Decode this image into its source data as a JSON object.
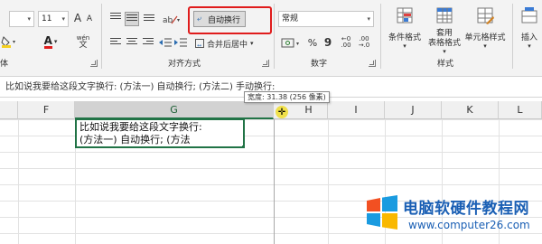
{
  "ribbon": {
    "font_group": {
      "font_size": "11",
      "label": "体",
      "grow_font_icon": "A",
      "shrink_font_icon": "A",
      "font_color_icon": "A",
      "phonetic_icon": "wén"
    },
    "alignment_group": {
      "wrap_text_label": "自动换行",
      "merge_center_label": "合并后居中",
      "label": "对齐方式"
    },
    "number_group": {
      "format_value": "常规",
      "percent_icon": "%",
      "comma_icon": "9",
      "decimal_inc_icon": ".00",
      "label": "数字"
    },
    "styles_group": {
      "conditional_format_label": "条件格式",
      "table_format_label_1": "套用",
      "table_format_label_2": "表格格式",
      "cell_styles_label": "单元格样式",
      "label": "样式"
    },
    "cells_group": {
      "insert_label": "插入"
    }
  },
  "formula_bar": {
    "content": "比如说我要给这段文字换行:   (方法一) 自动换行;   (方法二) 手动换行:"
  },
  "tooltip": {
    "text": "宽度: 31.38 (256 像素)"
  },
  "grid": {
    "columns": [
      "F",
      "G",
      "H",
      "I",
      "J",
      "K",
      "L"
    ],
    "active_cell_lines": [
      "比如说我要给这段文字换行:",
      " (方法一) 自动换行;  (方法"
    ]
  },
  "watermark": {
    "title": "电脑软硬件教程网",
    "url": "www.computer26.com"
  },
  "colors": {
    "accent_green": "#217346",
    "highlight_red": "#e01c1c",
    "brand_blue": "#1a5fb4"
  }
}
